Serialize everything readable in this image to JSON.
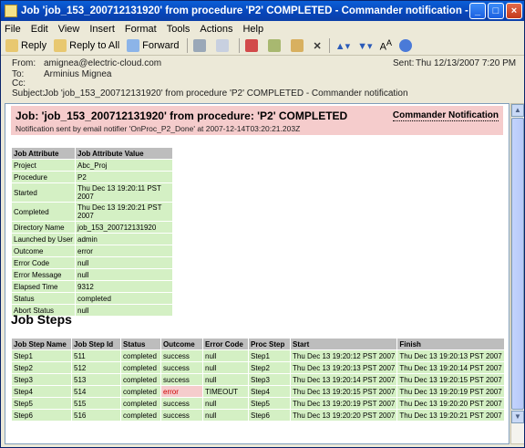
{
  "window": {
    "title": "Job 'job_153_200712131920' from procedure 'P2' COMPLETED  - Commander notification - Message (HTML)"
  },
  "menu": [
    "File",
    "Edit",
    "View",
    "Insert",
    "Format",
    "Tools",
    "Actions",
    "Help"
  ],
  "toolbar": {
    "reply": "Reply",
    "reply_all": "Reply to All",
    "forward": "Forward"
  },
  "header": {
    "from_label": "From:",
    "from": "amignea@electric-cloud.com",
    "to_label": "To:",
    "to": "Arminius Mignea",
    "cc_label": "Cc:",
    "cc": "",
    "subject_label": "Subject:",
    "subject": "Job 'job_153_200712131920' from procedure 'P2' COMPLETED  - Commander notification",
    "sent_label": "Sent:",
    "sent": "Thu 12/13/2007 7:20 PM"
  },
  "banner": {
    "title": "Job: 'job_153_200712131920' from procedure: 'P2' COMPLETED",
    "link": "Commander Notification",
    "subtitle": "Notification sent by email notifier 'OnProc_P2_Done' at 2007-12-14T03:20:21.203Z"
  },
  "attributes": {
    "headers": [
      "Job Attribute",
      "Job Attribute Value"
    ],
    "rows": [
      [
        "Project",
        "Abc_Proj"
      ],
      [
        "Procedure",
        "P2"
      ],
      [
        "Started",
        "Thu Dec 13 19:20:11 PST 2007"
      ],
      [
        "Completed",
        "Thu Dec 13 19:20:21 PST 2007"
      ],
      [
        "Directory Name",
        "job_153_200712131920"
      ],
      [
        "Launched by User",
        "admin"
      ],
      [
        "Outcome",
        "error"
      ],
      [
        "Error Code",
        "null"
      ],
      [
        "Error Message",
        "null"
      ],
      [
        "Elapsed Time",
        "9312"
      ],
      [
        "Status",
        "completed"
      ],
      [
        "Abort Status",
        "null"
      ]
    ]
  },
  "steps": {
    "title": "Job Steps",
    "headers": [
      "Job Step Name",
      "Job Step Id",
      "Status",
      "Outcome",
      "Error Code",
      "Proc Step",
      "Start",
      "Finish"
    ],
    "rows": [
      [
        "Step1",
        "511",
        "completed",
        "success",
        "null",
        "Step1",
        "Thu Dec 13 19:20:12 PST 2007",
        "Thu Dec 13 19:20:13 PST 2007"
      ],
      [
        "Step2",
        "512",
        "completed",
        "success",
        "null",
        "Step2",
        "Thu Dec 13 19:20:13 PST 2007",
        "Thu Dec 13 19:20:14 PST 2007"
      ],
      [
        "Step3",
        "513",
        "completed",
        "success",
        "null",
        "Step3",
        "Thu Dec 13 19:20:14 PST 2007",
        "Thu Dec 13 19:20:15 PST 2007"
      ],
      [
        "Step4",
        "514",
        "completed",
        "error",
        "TIMEOUT",
        "Step4",
        "Thu Dec 13 19:20:15 PST 2007",
        "Thu Dec 13 19:20:19 PST 2007"
      ],
      [
        "Step5",
        "515",
        "completed",
        "success",
        "null",
        "Step5",
        "Thu Dec 13 19:20:19 PST 2007",
        "Thu Dec 13 19:20:20 PST 2007"
      ],
      [
        "Step6",
        "516",
        "completed",
        "success",
        "null",
        "Step6",
        "Thu Dec 13 19:20:20 PST 2007",
        "Thu Dec 13 19:20:21 PST 2007"
      ]
    ]
  }
}
